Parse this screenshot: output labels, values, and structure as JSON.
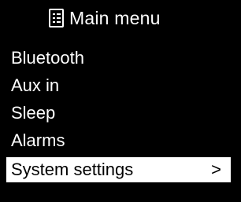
{
  "header": {
    "icon": "list-icon",
    "title": "Main menu"
  },
  "menu": {
    "items": [
      {
        "label": "Bluetooth"
      },
      {
        "label": "Aux in"
      },
      {
        "label": "Sleep"
      },
      {
        "label": "Alarms"
      },
      {
        "label": "System settings",
        "arrow": ">",
        "selected": true
      }
    ]
  },
  "colors": {
    "background": "#000000",
    "text": "#ffffff",
    "highlight_background": "#ffffff",
    "highlight_text": "#000000"
  }
}
